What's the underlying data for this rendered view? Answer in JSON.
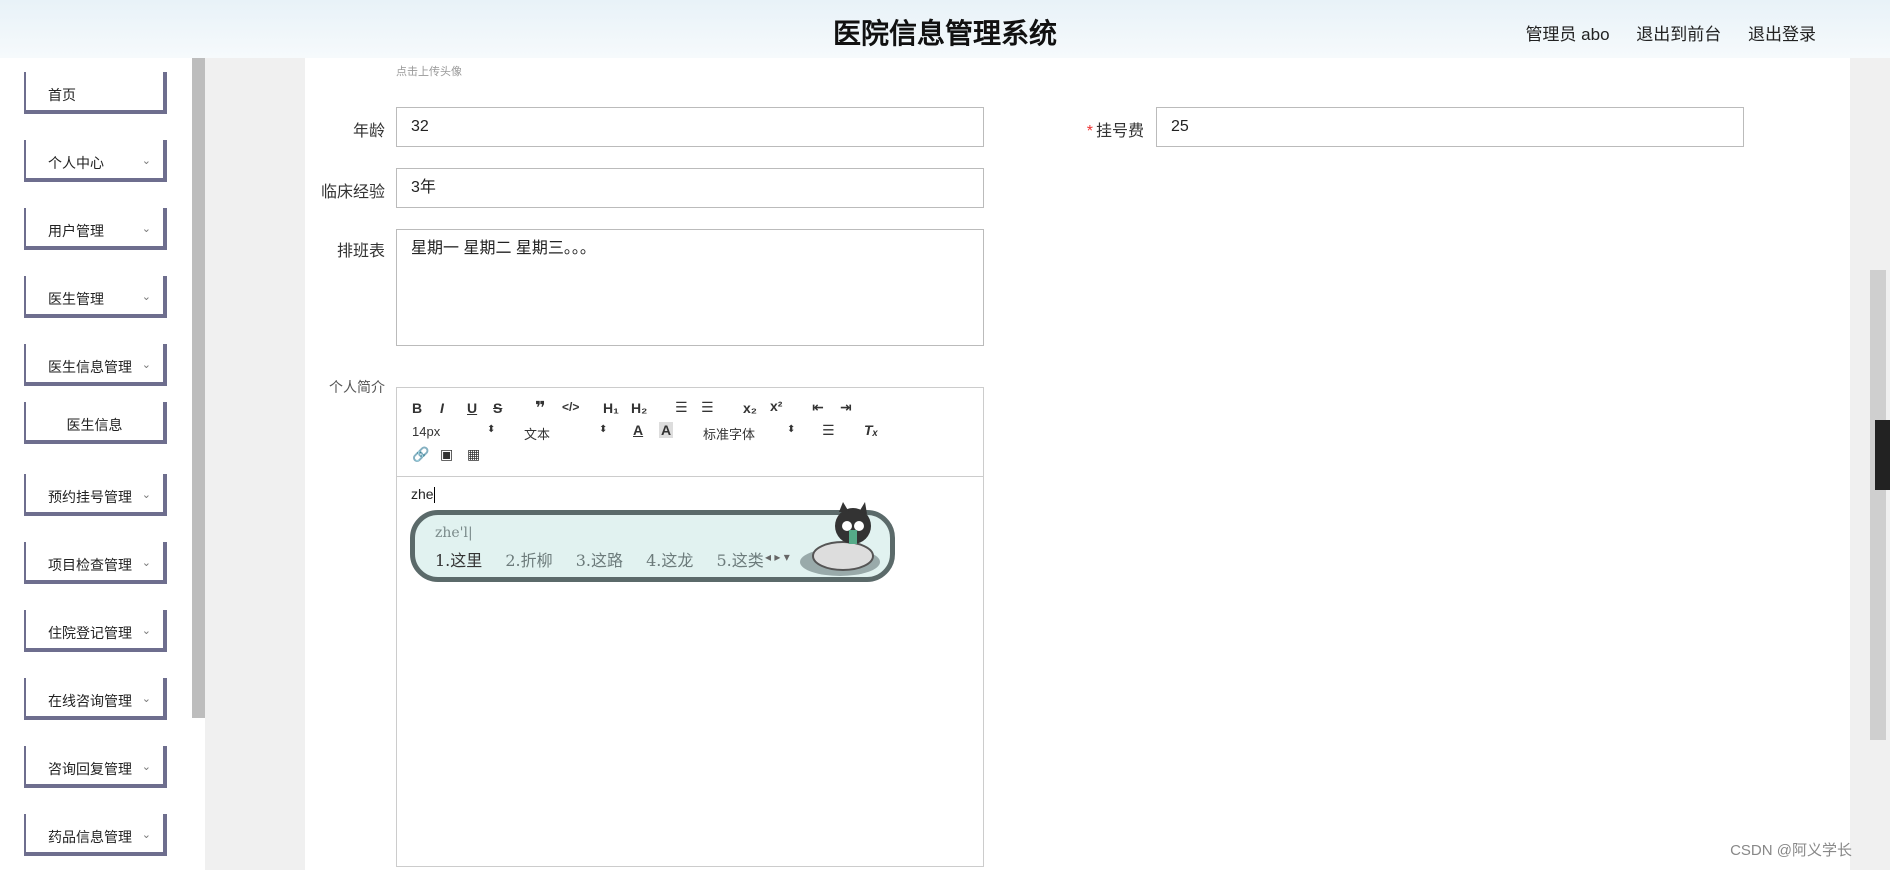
{
  "header": {
    "title": "医院信息管理系统",
    "user": "管理员 abo",
    "to_front": "退出到前台",
    "logout": "退出登录"
  },
  "sidebar": {
    "items": [
      {
        "label": "首页",
        "chevron": ""
      },
      {
        "label": "个人中心",
        "chevron": "⌄"
      },
      {
        "label": "用户管理",
        "chevron": "⌄"
      },
      {
        "label": "医生管理",
        "chevron": "⌄"
      },
      {
        "label": "医生信息管理",
        "chevron": "⌄"
      },
      {
        "label": "医生信息",
        "chevron": ""
      },
      {
        "label": "预约挂号管理",
        "chevron": "⌄"
      },
      {
        "label": "项目检查管理",
        "chevron": "⌄"
      },
      {
        "label": "住院登记管理",
        "chevron": "⌄"
      },
      {
        "label": "在线咨询管理",
        "chevron": "⌄"
      },
      {
        "label": "咨询回复管理",
        "chevron": "⌄"
      },
      {
        "label": "药品信息管理",
        "chevron": "⌄"
      }
    ]
  },
  "form": {
    "avatar_hint": "点击上传头像",
    "age_label": "年龄",
    "age_value": "32",
    "fee_required": "*",
    "fee_label": "挂号费",
    "fee_value": "25",
    "exp_label": "临床经验",
    "exp_value": "3年",
    "schedule_label": "排班表",
    "schedule_value": "星期一 星期二 星期三。。。",
    "intro_label": "个人简介"
  },
  "editor": {
    "font_size": "14px",
    "block": "文本",
    "font_family": "标准字体",
    "content": "zhe"
  },
  "ime": {
    "composition": "zhe'l|",
    "candidates": [
      "1.这里",
      "2.折柳",
      "3.这路",
      "4.这龙",
      "5.这类"
    ]
  },
  "watermark": "CSDN @阿义学长"
}
